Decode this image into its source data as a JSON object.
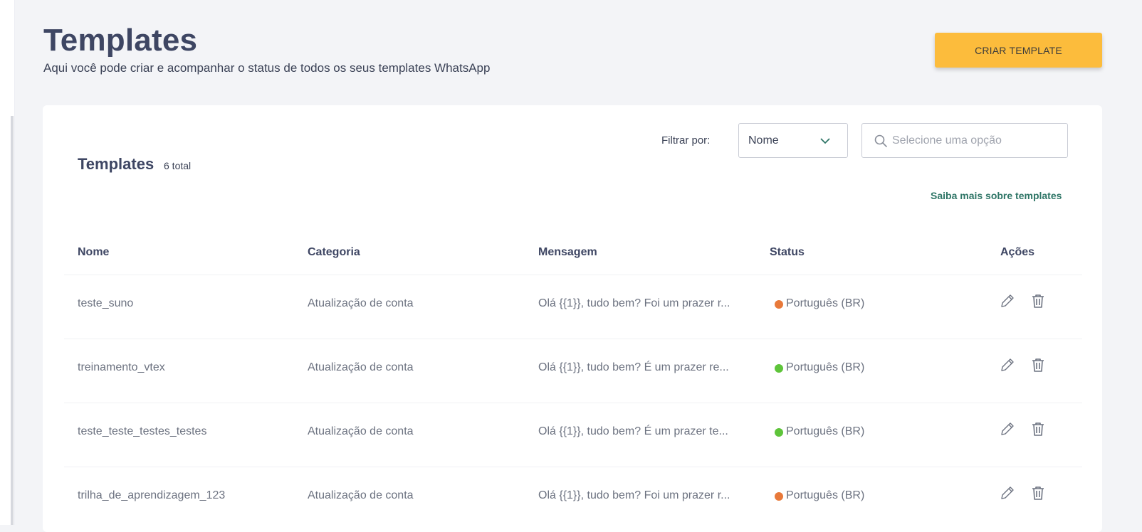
{
  "header": {
    "title": "Templates",
    "subtitle": "Aqui você pode criar e acompanhar o status de todos os seus templates WhatsApp",
    "create_button": "CRIAR TEMPLATE"
  },
  "card": {
    "title": "Templates",
    "count": "6 total",
    "filter_label": "Filtrar por:",
    "filter_value": "Nome",
    "search_placeholder": "Selecione uma opção",
    "learn_more": "Saiba mais sobre templates"
  },
  "table": {
    "columns": [
      "Nome",
      "Categoria",
      "Mensagem",
      "Status",
      "Ações"
    ],
    "rows": [
      {
        "name": "teste_suno",
        "category": "Atualização de conta",
        "message": "Olá {{1}}, tudo bem? Foi um prazer r...",
        "status": "Português (BR)",
        "status_color": "#e8793a"
      },
      {
        "name": "treinamento_vtex",
        "category": "Atualização de conta",
        "message": "Olá {{1}}, tudo bem? É um prazer re...",
        "status": "Português (BR)",
        "status_color": "#5ec43a"
      },
      {
        "name": "teste_teste_testes_testes",
        "category": "Atualização de conta",
        "message": "Olá {{1}}, tudo bem? É um prazer te...",
        "status": "Português (BR)",
        "status_color": "#5ec43a"
      },
      {
        "name": "trilha_de_aprendizagem_123",
        "category": "Atualização de conta",
        "message": "Olá {{1}}, tudo bem? Foi um prazer r...",
        "status": "Português (BR)",
        "status_color": "#e8793a"
      }
    ]
  },
  "icons": {
    "edit": "pencil-icon",
    "delete": "trash-icon",
    "search": "search-icon",
    "dropdown": "chevron-down-icon"
  },
  "colors": {
    "accent_button": "#fcbc3c",
    "link": "#2e7566",
    "status_pending": "#e8793a",
    "status_approved": "#5ec43a"
  }
}
